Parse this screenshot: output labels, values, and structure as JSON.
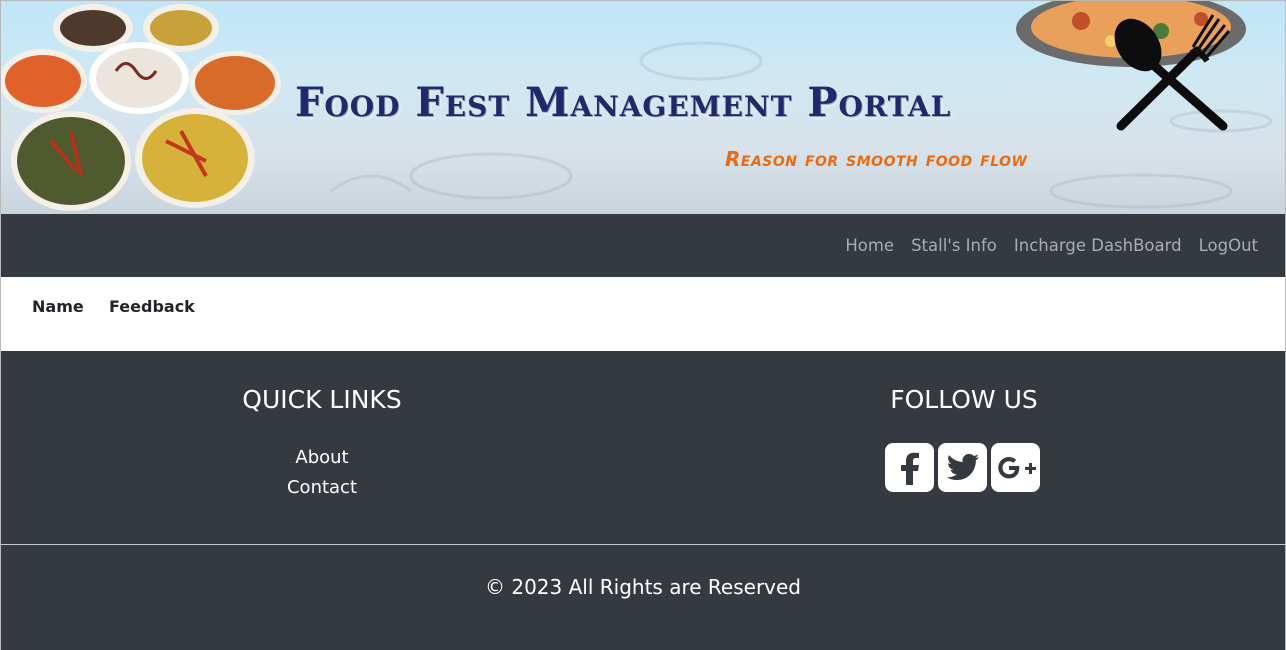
{
  "header": {
    "title": "Food Fest Management Portal",
    "tagline": "Reason for smooth food flow",
    "logo_icon": "spoon-fork-crossed-icon",
    "image": "food-dishes-collage"
  },
  "navbar": {
    "items": [
      {
        "label": "Home"
      },
      {
        "label": "Stall's Info"
      },
      {
        "label": "Incharge DashBoard"
      },
      {
        "label": "LogOut"
      }
    ]
  },
  "table": {
    "headers": [
      "Name",
      "Feedback"
    ]
  },
  "footer": {
    "quick_links": {
      "title": "QUICK LINKS",
      "links": [
        "About",
        "Contact"
      ]
    },
    "follow_us": {
      "title": "FOLLOW US",
      "icons": [
        "facebook-icon",
        "twitter-icon",
        "google-plus-icon"
      ]
    },
    "copyright": "© 2023 All Rights are Reserved"
  },
  "colors": {
    "navbar_bg": "#343a40",
    "nav_link": "#a9adb2",
    "title": "#1f2a6a",
    "tagline": "#ea6a12"
  }
}
